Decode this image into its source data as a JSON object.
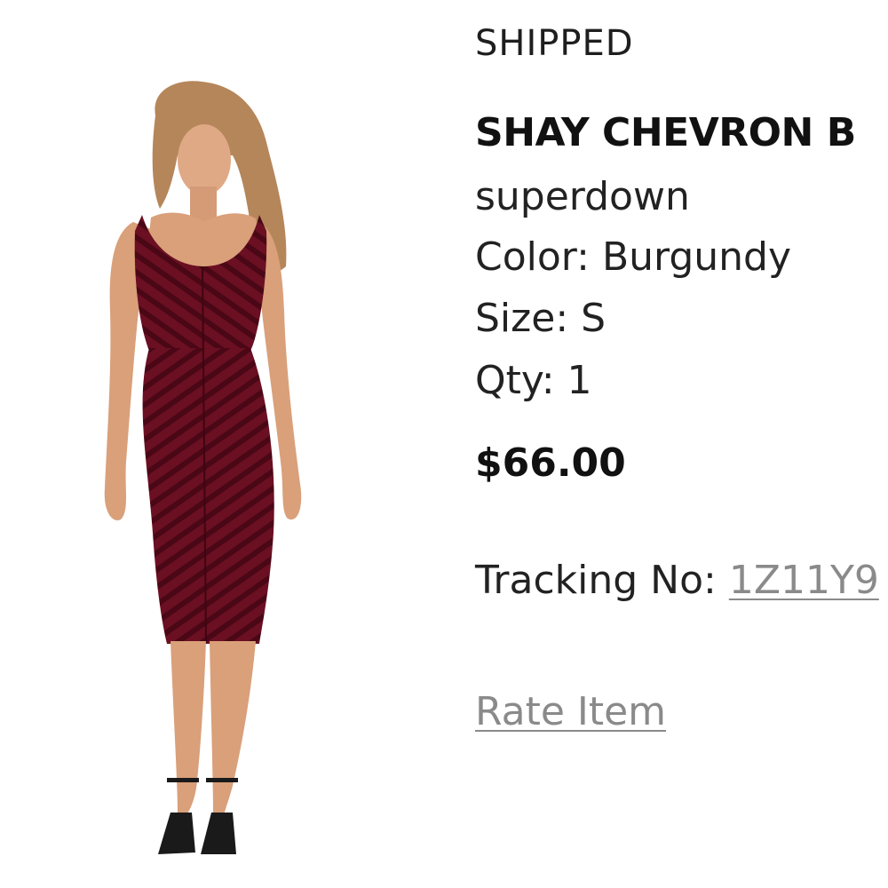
{
  "order_item": {
    "status": "SHIPPED",
    "product_name": "SHAY CHEVRON B",
    "brand": "superdown",
    "color_label": "Color:",
    "color_value": "Burgundy",
    "size_label": "Size:",
    "size_value": "S",
    "qty_label": "Qty:",
    "qty_value": "1",
    "price": "$66.00",
    "tracking_label": "Tracking No:",
    "tracking_number": "1Z11Y9",
    "rate_item_label": "Rate Item"
  },
  "image": {
    "icon": "product-photo-icon",
    "dress_color": "#6b0f22",
    "skin_color": "#d9a07a",
    "hair_color": "#b5865a"
  },
  "colors": {
    "text": "#1b1b1b",
    "link": "#8a8a8a",
    "background": "#ffffff"
  }
}
